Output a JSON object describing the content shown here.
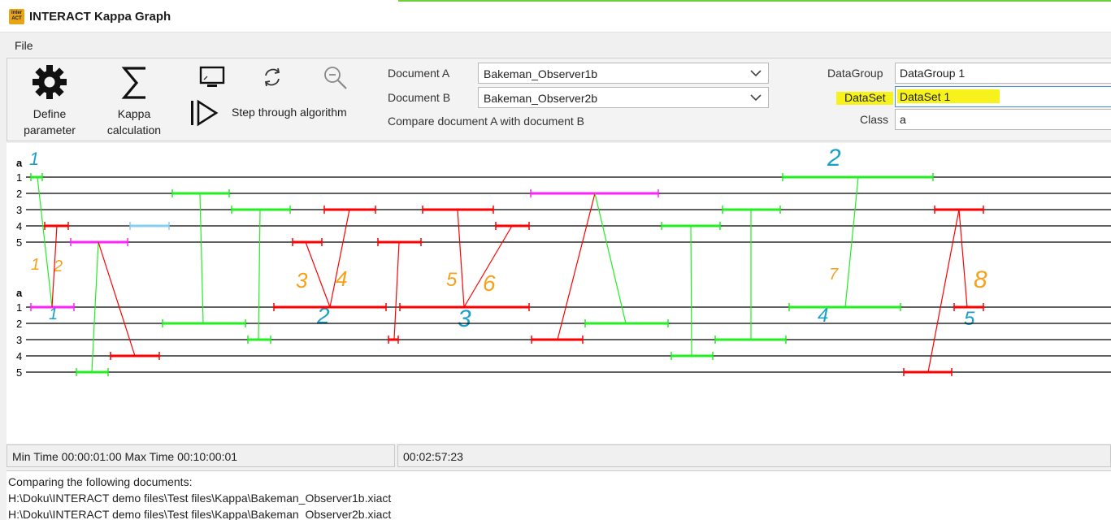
{
  "window": {
    "title": "INTERACT Kappa Graph",
    "icon_text_top": "inter",
    "icon_text_bottom": "ACT"
  },
  "menu": {
    "file_label": "File"
  },
  "toolbar": {
    "define_parameter": {
      "line1": "Define",
      "line2": "parameter",
      "icon": "gear-icon"
    },
    "kappa_calculation": {
      "line1": "Kappa",
      "line2": "calculation",
      "icon": "sigma-icon"
    },
    "step_through_label": "Step through algorithm",
    "icons": [
      "monitor-icon",
      "refresh-icon",
      "zoom-out-icon",
      "step-forward-icon"
    ]
  },
  "form": {
    "document_a_label": "Document A",
    "document_a_value": "Bakeman_Observer1b",
    "document_b_label": "Document B",
    "document_b_value": "Bakeman_Observer2b",
    "compare_text": "Compare document A with document B",
    "datagroup_label": "DataGroup",
    "datagroup_value": "DataGroup 1",
    "dataset_label": "DataSet",
    "dataset_value": "DataSet 1",
    "class_label": "Class",
    "class_value": "a"
  },
  "graph": {
    "class_label": "a",
    "row_labels": [
      "1",
      "2",
      "3",
      "4",
      "5"
    ],
    "colors": {
      "green": "#22ee22",
      "red": "#ff0000",
      "magenta": "#ff22ff",
      "lightblue": "#88ccf0",
      "axis": "#000000",
      "annot_blue": "#1aa0c8",
      "annot_orange": "#f5a21a"
    },
    "annotations_blue": [
      "1",
      "1",
      "2",
      "2",
      "3",
      "4",
      "5"
    ],
    "annotations_orange": [
      "1",
      "2",
      "3",
      "4",
      "5",
      "6",
      "7",
      "8"
    ]
  },
  "status": {
    "time_range": "Min Time 00:00:01:00  Max Time 00:10:00:01",
    "current_time": "00:02:57:23"
  },
  "log": {
    "lines": [
      "Comparing the following documents:",
      "H:\\Doku\\INTERACT demo files\\Test files\\Kappa\\Bakeman_Observer1b.xiact",
      "H:\\Doku\\INTERACT demo files\\Test files\\Kappa\\Bakeman_Observer2b.xiact"
    ]
  }
}
